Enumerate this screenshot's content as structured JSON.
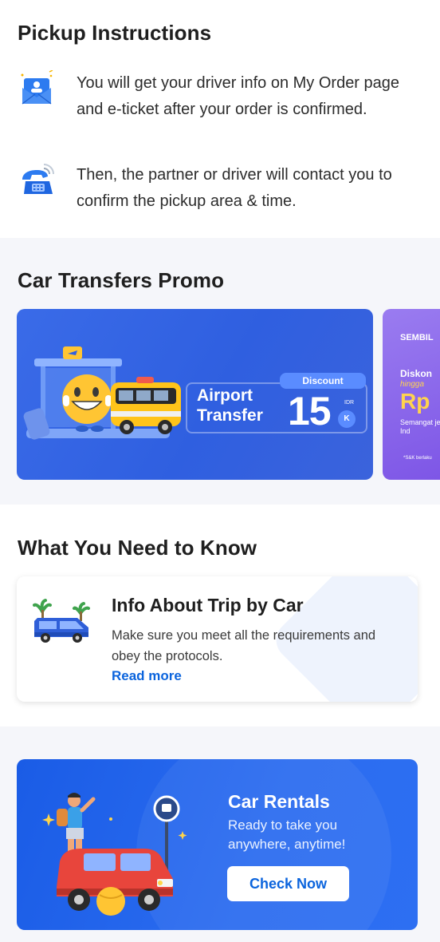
{
  "pickup": {
    "title": "Pickup Instructions",
    "items": [
      {
        "icon": "envelope-driver-icon",
        "text": "You will get your driver info on My Order page and e-ticket after your order is confirmed."
      },
      {
        "icon": "telephone-icon",
        "text": "Then, the partner or driver will contact you to confirm the pickup area & time."
      }
    ]
  },
  "promo": {
    "title": "Car Transfers Promo",
    "card1": {
      "headline": "Airport Transfer",
      "discount_label": "Discount",
      "amount": "15",
      "currency": "IDR",
      "unit": "K"
    },
    "card2": {
      "title": "SEMBIL",
      "diskon": "Diskon",
      "hingga": "hingga",
      "rp": "Rp",
      "line": "Semangat jelajah Ind",
      "sk": "*S&K berlaku"
    }
  },
  "know": {
    "title": "What You Need to Know",
    "card": {
      "title": "Info About Trip by Car",
      "description": "Make sure you meet all the requirements and obey the protocols.",
      "link": "Read more"
    }
  },
  "rental": {
    "title": "Car Rentals",
    "description": "Ready to take you anywhere, anytime!",
    "button": "Check Now"
  },
  "colors": {
    "accent_blue": "#0b64dd",
    "promo_blue": "#2f5fe0",
    "promo_purple": "#7d55e6",
    "section_grey": "#f5f6fa"
  }
}
